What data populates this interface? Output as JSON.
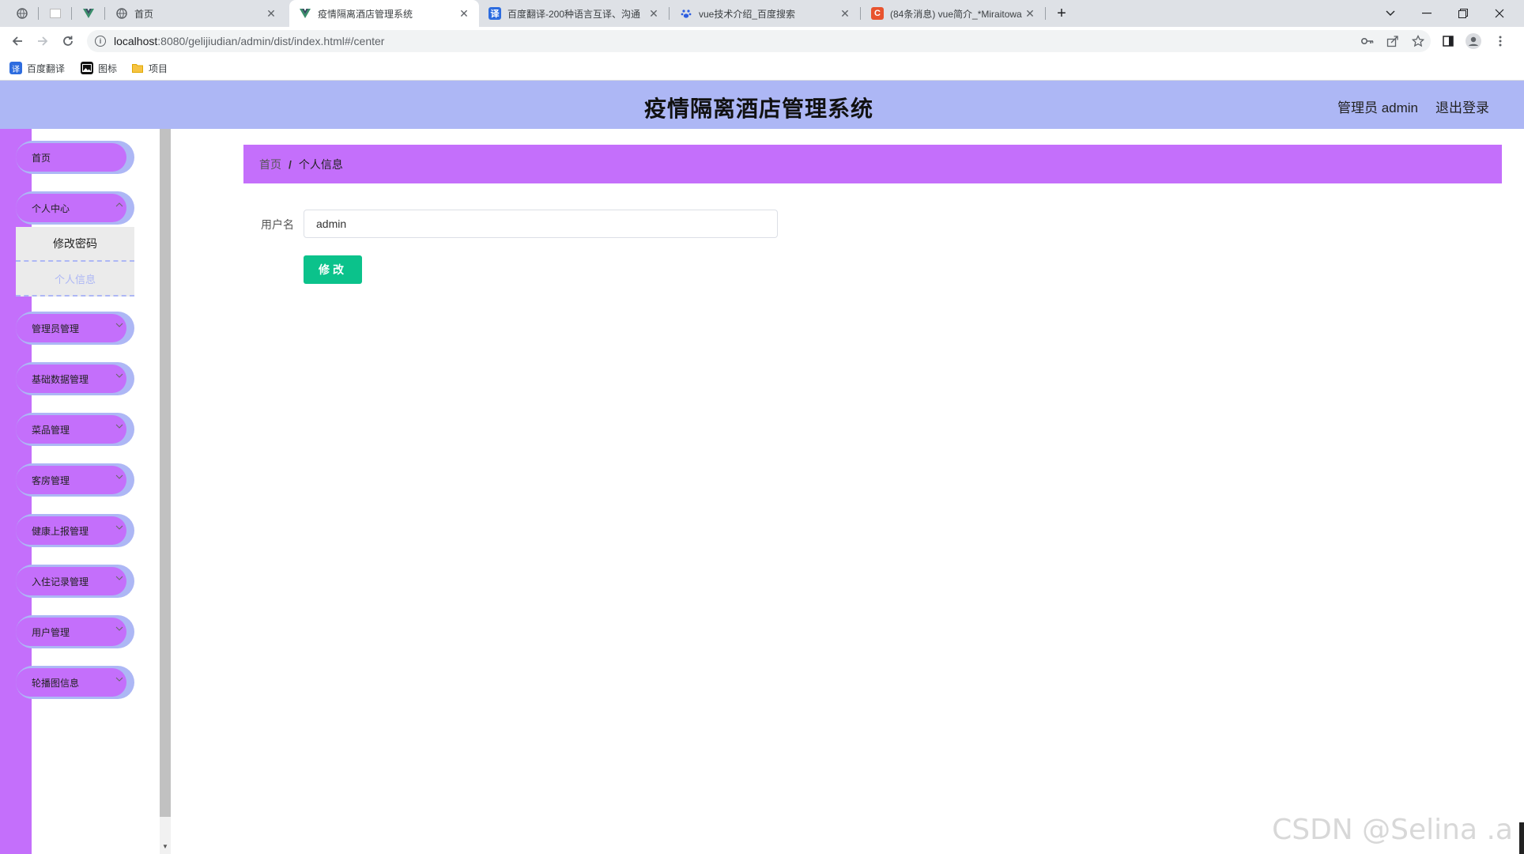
{
  "browser": {
    "tabs": [
      {
        "title": "",
        "icon": "globe-icon"
      },
      {
        "title": "",
        "icon": "blank-page-icon"
      },
      {
        "title": "",
        "icon": "vue-icon"
      },
      {
        "title": "首页",
        "icon": "globe-icon"
      },
      {
        "title": "疫情隔离酒店管理系统",
        "icon": "vue-icon",
        "active": true
      },
      {
        "title": "百度翻译-200种语言互译、沟通",
        "icon": "baidu-translate-icon"
      },
      {
        "title": "vue技术介绍_百度搜索",
        "icon": "baidu-paw-icon"
      },
      {
        "title": "(84条消息) vue简介_*Miraitowa",
        "icon": "csdn-icon"
      }
    ],
    "new_tab": "+",
    "url_host": "localhost",
    "url_path": ":8080/gelijiudian/admin/dist/index.html#/center",
    "bookmarks": [
      {
        "label": "百度翻译",
        "icon": "baidu-translate-icon"
      },
      {
        "label": "图标",
        "icon": "image-icon"
      },
      {
        "label": "项目",
        "icon": "folder-icon"
      }
    ]
  },
  "header": {
    "title": "疫情隔离酒店管理系统",
    "user": "管理员 admin",
    "logout": "退出登录"
  },
  "sidebar": {
    "items": [
      {
        "label": "首页",
        "has_children": false
      },
      {
        "label": "个人中心",
        "has_children": true,
        "expanded": true,
        "children": [
          {
            "label": "修改密码"
          },
          {
            "label": "个人信息",
            "active": true
          }
        ]
      },
      {
        "label": "管理员管理",
        "has_children": true
      },
      {
        "label": "基础数据管理",
        "has_children": true
      },
      {
        "label": "菜品管理",
        "has_children": true
      },
      {
        "label": "客房管理",
        "has_children": true
      },
      {
        "label": "健康上报管理",
        "has_children": true
      },
      {
        "label": "入住记录管理",
        "has_children": true
      },
      {
        "label": "用户管理",
        "has_children": true
      },
      {
        "label": "轮播图信息",
        "has_children": true
      }
    ]
  },
  "breadcrumb": {
    "home": "首页",
    "separator": "/",
    "current": "个人信息"
  },
  "form": {
    "username_label": "用户名",
    "username_value": "admin",
    "submit_label": "修改"
  },
  "watermark": "CSDN @Selina .a",
  "colors": {
    "header_bg": "#adb7f5",
    "accent_purple": "#c46ffb",
    "submit_green": "#0bc28b"
  }
}
